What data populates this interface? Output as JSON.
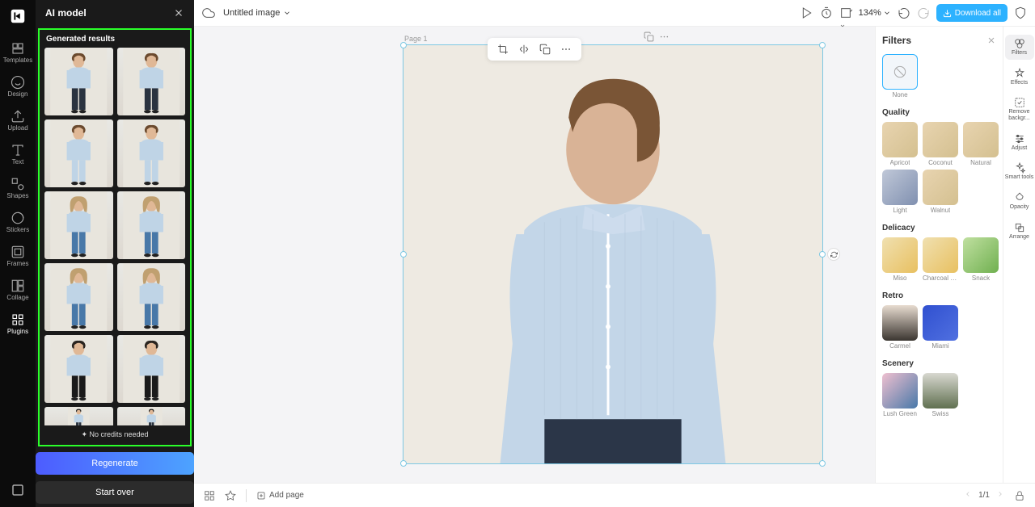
{
  "nav_rail": {
    "items": [
      {
        "id": "templates",
        "label": "Templates"
      },
      {
        "id": "design",
        "label": "Design"
      },
      {
        "id": "upload",
        "label": "Upload"
      },
      {
        "id": "text",
        "label": "Text"
      },
      {
        "id": "shapes",
        "label": "Shapes"
      },
      {
        "id": "stickers",
        "label": "Stickers"
      },
      {
        "id": "frames",
        "label": "Frames"
      },
      {
        "id": "collage",
        "label": "Collage"
      },
      {
        "id": "plugins",
        "label": "Plugins"
      }
    ]
  },
  "ai_panel": {
    "title": "AI model",
    "section_title": "Generated results",
    "credits_text": "✦ No credits needed",
    "regenerate_label": "Regenerate",
    "start_over_label": "Start over"
  },
  "topbar": {
    "title": "Untitled image",
    "zoom": "134%",
    "download_label": "Download all"
  },
  "canvas": {
    "page_label": "Page 1"
  },
  "filters_panel": {
    "title": "Filters",
    "none_label": "None",
    "sections": [
      {
        "name": "Quality",
        "items": [
          {
            "label": "Apricot",
            "cls": ""
          },
          {
            "label": "Coconut",
            "cls": ""
          },
          {
            "label": "Natural",
            "cls": ""
          },
          {
            "label": "Light",
            "cls": "light"
          },
          {
            "label": "Walnut",
            "cls": ""
          }
        ]
      },
      {
        "name": "Delicacy",
        "items": [
          {
            "label": "Miso",
            "cls": "miso"
          },
          {
            "label": "Charcoal fr...",
            "cls": "miso"
          },
          {
            "label": "Snack",
            "cls": "snack"
          }
        ]
      },
      {
        "name": "Retro",
        "items": [
          {
            "label": "Carmel",
            "cls": "carmel"
          },
          {
            "label": "Miami",
            "cls": "miami"
          }
        ]
      },
      {
        "name": "Scenery",
        "items": [
          {
            "label": "Lush Green",
            "cls": "lush"
          },
          {
            "label": "Swiss",
            "cls": "swiss"
          }
        ]
      }
    ]
  },
  "tool_rail": {
    "items": [
      {
        "id": "filters",
        "label": "Filters",
        "active": true
      },
      {
        "id": "effects",
        "label": "Effects"
      },
      {
        "id": "remove",
        "label": "Remove backgr..."
      },
      {
        "id": "adjust",
        "label": "Adjust"
      },
      {
        "id": "smart",
        "label": "Smart tools"
      },
      {
        "id": "opacity",
        "label": "Opacity"
      },
      {
        "id": "arrange",
        "label": "Arrange"
      }
    ]
  },
  "bottombar": {
    "add_page_label": "Add page",
    "page_indicator": "1/1"
  }
}
